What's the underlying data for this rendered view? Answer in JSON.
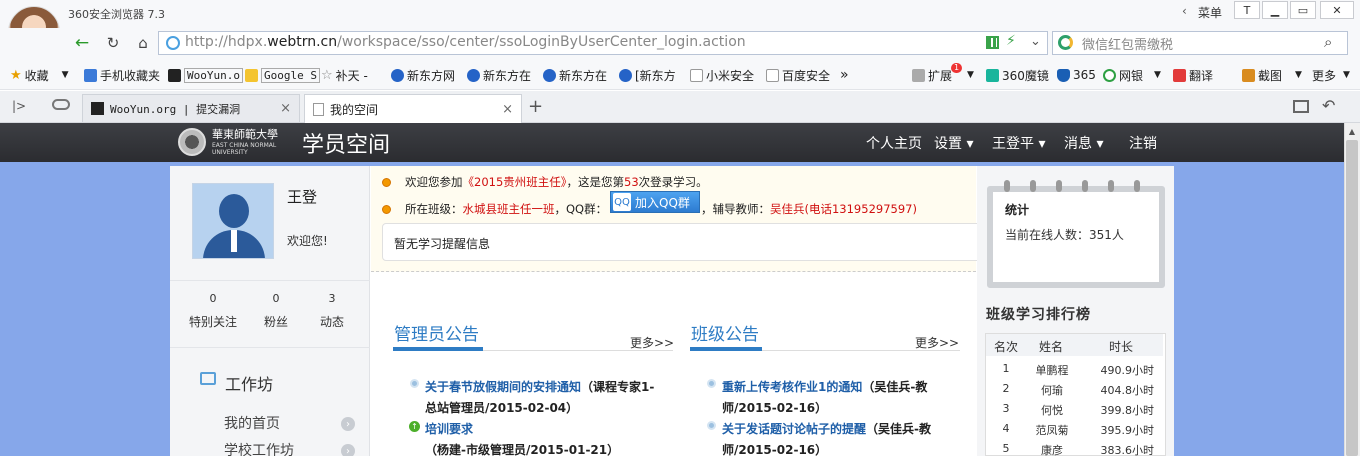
{
  "window": {
    "title": "360安全浏览器 7.3",
    "menu_label": "菜单",
    "menu_arrow": "‹",
    "min": "▁",
    "max": "▭",
    "close": "✕",
    "shirt": "T"
  },
  "nav": {
    "url_host_pre": "http://hdpx.",
    "url_host_bold": "webtrn.cn",
    "url_path": "/workspace/sso/center/ssoLoginByUserCenter_login.action",
    "search_placeholder": "微信红包需缴税",
    "back": "←",
    "reload": "↻",
    "home": "⌂",
    "dropdown": "⌄",
    "search_icon": "⌕",
    "bolt": "⚡"
  },
  "bookmarks": [
    {
      "label": "收藏",
      "icon": "star-icon"
    },
    {
      "label": "手机收藏夹",
      "icon": "phone-icon"
    },
    {
      "label": "WooYun.o",
      "icon": "wooyun-icon"
    },
    {
      "label": "Google S",
      "icon": "google-icon"
    },
    {
      "label": "补天 -",
      "icon": "star-outline-icon"
    },
    {
      "label": "新东方网",
      "icon": "paw-icon"
    },
    {
      "label": "新东方在",
      "icon": "paw-icon"
    },
    {
      "label": "新东方在",
      "icon": "paw-icon"
    },
    {
      "label": "[新东方",
      "icon": "paw-icon"
    },
    {
      "label": "小米安全",
      "icon": "doc-icon"
    },
    {
      "label": "百度安全",
      "icon": "doc-icon"
    }
  ],
  "bookbar_more": "»",
  "tools": [
    {
      "label": "扩展",
      "icon": "extension-icon"
    },
    {
      "label": "360魔镜",
      "icon": "mirror-icon"
    },
    {
      "label": "365",
      "icon": "shield-icon"
    },
    {
      "label": "网银",
      "icon": "yen-icon"
    },
    {
      "label": "翻译",
      "icon": "translate-icon"
    },
    {
      "label": "截图",
      "icon": "screenshot-icon"
    },
    {
      "label": "更多",
      "icon": "more-icon"
    }
  ],
  "ext_badge": "1",
  "tabs": [
    {
      "label": "WooYun.org | 提交漏洞",
      "close": "×"
    },
    {
      "label": "我的空间",
      "close": "×"
    }
  ],
  "tab_add": "+",
  "site": {
    "uni_name": "華東師範大學",
    "uni_en": "EAST CHINA NORMAL UNIVERSITY",
    "title": "学员空间",
    "nav": [
      "个人主页",
      "设置 ▾",
      "王登平 ▾",
      "消息 ▾",
      "注销"
    ]
  },
  "profile": {
    "name": "王登",
    "welcome": "欢迎您!",
    "stats": [
      {
        "num": "0",
        "label": "特别关注"
      },
      {
        "num": "0",
        "label": "粉丝"
      },
      {
        "num": "3",
        "label": "动态"
      }
    ],
    "workshop_title": "工作坊",
    "menu": [
      "我的首页",
      "学校工作坊"
    ],
    "menu_arrow": "›"
  },
  "notice": {
    "line1_pre": "欢迎您参加",
    "line1_course": "《2015贵州班主任》",
    "line1_mid": "，这是您第",
    "line1_count": "53",
    "line1_post": "次登录学习。",
    "line2_pre": "所在班级：",
    "line2_class": "水城县班主任一班",
    "line2_qq": "，QQ群：",
    "qq_button": "加入QQ群",
    "line2_tutor_pre": "，辅导教师：",
    "line2_tutor": "吴佳兵(电话13195297597)",
    "remind": "暂无学习提醒信息"
  },
  "admin": {
    "title": "管理员公告",
    "more": "更多>>",
    "items": [
      {
        "title": "关于春节放假期间的安排通知",
        "meta": "（课程专家1-总站管理员/2015-02-04）",
        "icon": "dot"
      },
      {
        "title": "培训要求",
        "meta": "（杨建-市级管理员/2015-01-21）",
        "icon": "new"
      }
    ]
  },
  "class": {
    "title": "班级公告",
    "more": "更多>>",
    "items": [
      {
        "title": "重新上传考核作业1的通知",
        "meta": "（吴佳兵-教师/2015-02-16）"
      },
      {
        "title": "关于发话题讨论帖子的提醒",
        "meta": "（吴佳兵-教师/2015-02-16）"
      }
    ]
  },
  "stats_card": {
    "title": "统计",
    "online_label": "当前在线人数：",
    "online_count": "351人"
  },
  "ranking": {
    "title": "班级学习排行榜",
    "headers": [
      "名次",
      "姓名",
      "时长"
    ],
    "rows": [
      [
        "1",
        "单鹏程",
        "490.9小时"
      ],
      [
        "2",
        "何瑜",
        "404.8小时"
      ],
      [
        "3",
        "何悦",
        "399.8小时"
      ],
      [
        "4",
        "范凤菊",
        "395.9小时"
      ],
      [
        "5",
        "康彦",
        "383.6小时"
      ]
    ]
  }
}
